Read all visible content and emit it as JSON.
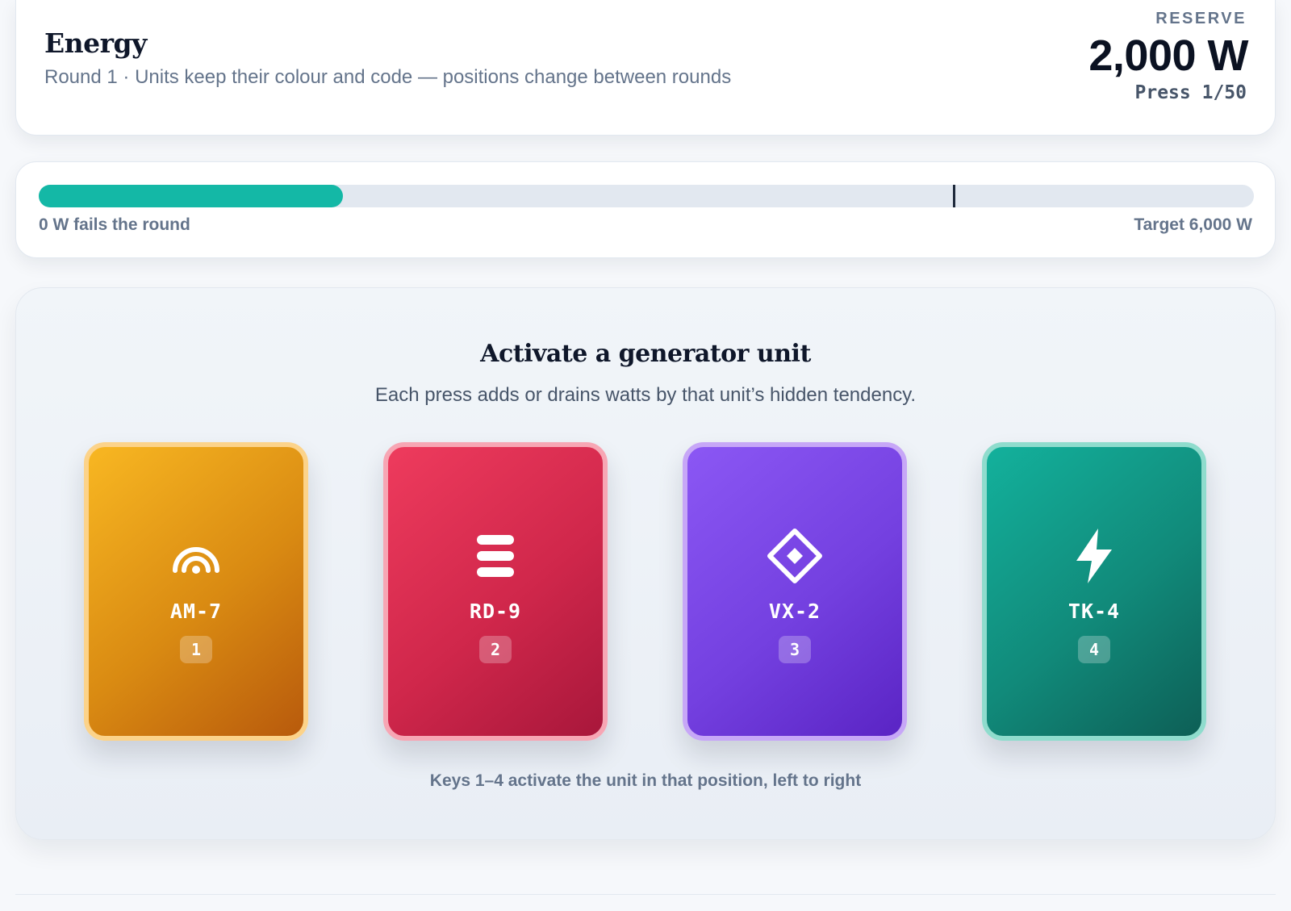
{
  "header": {
    "title": "Energy",
    "subtitle": "Round 1 · Units keep their colour and code — positions change between rounds",
    "reserve_label": "RESERVE",
    "reserve_value": "2,000 W",
    "press_count": "Press 1/50"
  },
  "progress": {
    "fill_fraction": 0.25,
    "target_marker_fraction": 0.752,
    "fail_label": "0 W fails the round",
    "target_label": "Target 6,000 W",
    "fill_color": "#14b8a6"
  },
  "panel": {
    "title": "Activate a generator unit",
    "description": "Each press adds or drains watts by that unit’s hidden tendency.",
    "hint": "Keys 1–4 activate the unit in that position, left to right"
  },
  "units": [
    {
      "code": "AM-7",
      "key": "1",
      "icon": "signal-arc-icon",
      "color": "#f5a623"
    },
    {
      "code": "RD-9",
      "key": "2",
      "icon": "stack-bars-icon",
      "color": "#e11d48"
    },
    {
      "code": "VX-2",
      "key": "3",
      "icon": "diamond-icon",
      "color": "#7c3aed"
    },
    {
      "code": "TK-4",
      "key": "4",
      "icon": "lightning-bolt-icon",
      "color": "#0f9f8a"
    }
  ]
}
